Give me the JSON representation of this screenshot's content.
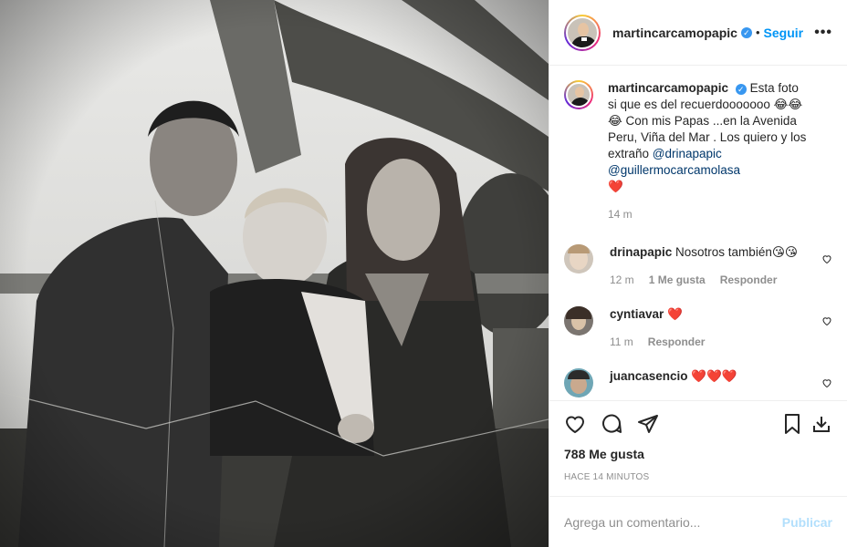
{
  "post": {
    "username": "martincarcamopapic",
    "follow_label": "Seguir",
    "more_label": "•••",
    "verified_mark": "✓",
    "separator": "•"
  },
  "caption": {
    "username": "martincarcamopapic",
    "text_1": "Esta foto si que es del recuerdooooooo 😂😂😂 Con mis Papas ...en la Avenida Peru, Viña del Mar . Los quiero y los extraño",
    "mention_1": "@drinapapic",
    "mention_2": "@guillermocarcamolasa",
    "heart": "❤️",
    "time": "14 m"
  },
  "comments": [
    {
      "username": "drinapapic",
      "text": "Nosotros también😘😘",
      "time": "12 m",
      "likes": "1 Me gusta",
      "reply": "Responder"
    },
    {
      "username": "cyntiavar",
      "text": "❤️",
      "time": "11 m",
      "reply": "Responder"
    },
    {
      "username": "juancasencio",
      "text": "❤️❤️❤️"
    }
  ],
  "stats": {
    "likes": "788 Me gusta",
    "posted": "Hace 14 minutos"
  },
  "add_comment": {
    "placeholder": "Agrega un comentario...",
    "publish": "Publicar"
  },
  "icons": [
    "heart-icon",
    "comment-icon",
    "share-icon",
    "save-icon",
    "download-icon",
    "more-icon",
    "verified-icon"
  ]
}
